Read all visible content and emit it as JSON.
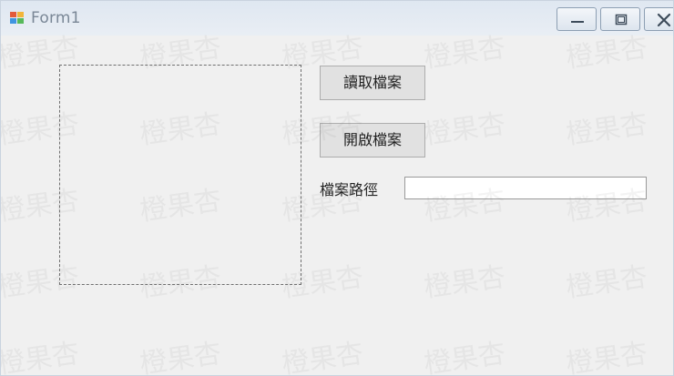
{
  "window": {
    "title": "Form1",
    "controls": {
      "minimize": "minimize",
      "maximize": "maximize",
      "close": "close"
    }
  },
  "form": {
    "read_file_button": "讀取檔案",
    "open_file_button": "開啟檔案",
    "file_path_label": "檔案路徑",
    "file_path_value": ""
  },
  "watermark": {
    "text": "橙果杏"
  },
  "icons": {
    "app": "windows-form-icon",
    "minimize": "minimize-icon",
    "maximize": "maximize-icon",
    "close": "close-icon"
  },
  "colors": {
    "background": "#f0f0f0",
    "titlebar": "#e4ebf3",
    "button": "#e1e1e1"
  }
}
